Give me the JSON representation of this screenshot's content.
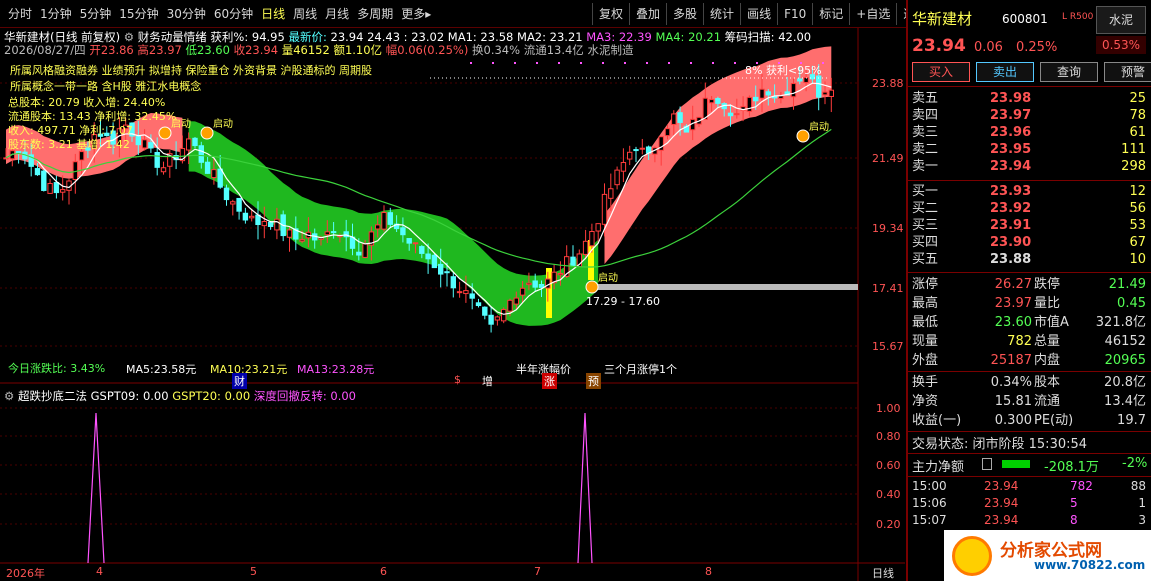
{
  "toolbar": {
    "periods": [
      "分时",
      "1分钟",
      "5分钟",
      "15分钟",
      "30分钟",
      "60分钟",
      "日线",
      "周线",
      "月线",
      "多周期",
      "更多▸"
    ],
    "active_period": "日线",
    "right_buttons": [
      "复权",
      "叠加",
      "多股",
      "统计",
      "画线",
      "F10",
      "标记",
      "+自选",
      "返回"
    ]
  },
  "chart": {
    "title": "华新建材(日线 前复权)",
    "indicator_name": "财务动量情绪",
    "profit_label": "获利%:",
    "profit_value": "94.95",
    "latest_label": "最新价:",
    "latest_value": "23.94",
    "range_value": "24.43 : 23.02",
    "ma1": "MA1: 23.58",
    "ma2": "MA2: 23.21",
    "ma3": "MA3: 22.39",
    "ma4": "MA4: 20.21",
    "chip": "筹码扫描: 42.00",
    "date": "2026/08/27/四",
    "open": "开23.86",
    "high": "高23.97",
    "low": "低23.60",
    "close": "收23.94",
    "vol": "量46152",
    "amount": "额1.10亿",
    "amp": "幅0.06(0.25%)",
    "turnover": "换0.34%",
    "float": "流通13.4亿",
    "sector": "水泥制造",
    "concepts1": "所属风格融资融券 业绩预升 拟增持 保险重仓 外资背景 沪股通标的 周期股",
    "concepts2": "所属概念一带一路 含H股 雅江水电概念",
    "equity": "总股本: 20.79  收入增: 24.40%",
    "float_eq": "流通股本: 13.43  净利增: 32.45%",
    "revenue": "收入: 497.71  净利: 7.07",
    "holders": "股东数: 3.21  基增: 1.42",
    "mcap_ratio": "今日涨跌比: 3.43%",
    "ma5": "MA5:23.58元",
    "ma10": "MA10:23.21元",
    "ma13": "MA13:23.28元",
    "annotation_top": "8% 获利<95%",
    "label_qidong": "启动",
    "label_range": "17.29 - 17.60",
    "half_year": "半年涨幅价",
    "three_month": "三个月涨停1个",
    "mark_cai": "财",
    "mark_s": "$",
    "mark_zeng": "增",
    "mark_zhang": "涨",
    "mark_yu": "预",
    "y_labels": [
      "23.88",
      "21.49",
      "19.34",
      "17.41",
      "15.67"
    ],
    "y_labels2": [
      "1.00",
      "0.80",
      "0.60",
      "0.40",
      "0.20"
    ]
  },
  "pane2": {
    "name": "超跌抄底二法",
    "gspt09": "GSPT09: 0.00",
    "gspt20": "GSPT20: 0.00",
    "deep": "深度回撤反转: 0.00"
  },
  "xaxis": {
    "year": "2026年",
    "months": [
      "4",
      "5",
      "6",
      "7",
      "8"
    ],
    "period": "日线"
  },
  "quote": {
    "name": "华新建材",
    "code": "600801",
    "lr": "L R500",
    "sector_tag": "水泥",
    "sector_pct": "0.53%",
    "price": "23.94",
    "change": "0.06",
    "pct": "0.25%",
    "buttons": [
      "买入",
      "卖出",
      "查询",
      "预警"
    ],
    "sells": [
      {
        "label": "卖五",
        "price": "23.98",
        "vol": "25"
      },
      {
        "label": "卖四",
        "price": "23.97",
        "vol": "78"
      },
      {
        "label": "卖三",
        "price": "23.96",
        "vol": "61"
      },
      {
        "label": "卖二",
        "price": "23.95",
        "vol": "111"
      },
      {
        "label": "卖一",
        "price": "23.94",
        "vol": "298"
      }
    ],
    "buys": [
      {
        "label": "买一",
        "price": "23.93",
        "vol": "12"
      },
      {
        "label": "买二",
        "price": "23.92",
        "vol": "56"
      },
      {
        "label": "买三",
        "price": "23.91",
        "vol": "53"
      },
      {
        "label": "买四",
        "price": "23.90",
        "vol": "67"
      },
      {
        "label": "买五",
        "price": "23.88",
        "vol": "10"
      }
    ],
    "stats": [
      {
        "l1": "涨停",
        "v1": "26.27",
        "c1": "#ff5454",
        "l2": "跌停",
        "v2": "21.49",
        "c2": "#54ff54"
      },
      {
        "l1": "最高",
        "v1": "23.97",
        "c1": "#ff5454",
        "l2": "量比",
        "v2": "0.45",
        "c2": "#54ff54"
      },
      {
        "l1": "最低",
        "v1": "23.60",
        "c1": "#54ff54",
        "l2": "市值A",
        "v2": "321.8亿",
        "c2": "#ddd"
      },
      {
        "l1": "现量",
        "v1": "782",
        "c1": "#ffff54",
        "l2": "总量",
        "v2": "46152",
        "c2": "#ddd"
      },
      {
        "l1": "外盘",
        "v1": "25187",
        "c1": "#ff5454",
        "l2": "内盘",
        "v2": "20965",
        "c2": "#54ff54"
      }
    ],
    "stats2": [
      {
        "l1": "换手",
        "v1": "0.34%",
        "c1": "#ddd",
        "l2": "股本",
        "v2": "20.8亿",
        "c2": "#ddd"
      },
      {
        "l1": "净资",
        "v1": "15.81",
        "c1": "#ddd",
        "l2": "流通",
        "v2": "13.4亿",
        "c2": "#ddd"
      },
      {
        "l1": "收益(一)",
        "v1": "0.300",
        "c1": "#ddd",
        "l2": "PE(动)",
        "v2": "19.7",
        "c2": "#ddd"
      }
    ],
    "trade_status": "交易状态: 闭市阶段 15:30:54",
    "main_flow_label": "主力净额",
    "main_flow_value": "-208.1万",
    "main_flow_pct": "-2%",
    "ticks": [
      {
        "t": "15:00",
        "p": "23.94",
        "v": "782",
        "n": "88"
      },
      {
        "t": "15:06",
        "p": "23.94",
        "v": "5",
        "n": "1"
      },
      {
        "t": "15:07",
        "p": "23.94",
        "v": "8",
        "n": "3"
      }
    ]
  },
  "logo": {
    "text": "分析家公式网",
    "url": "www.70822.com"
  }
}
